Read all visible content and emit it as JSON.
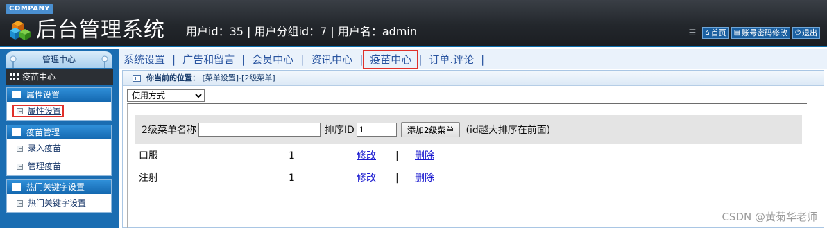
{
  "header": {
    "company": "COMPANY",
    "title": "后台管理系统",
    "user_info": "用户id：35 | 用户分组id：7 | 用户名：admin",
    "links": [
      {
        "label": "首页",
        "icon": "home-icon"
      },
      {
        "label": "账号密码修改",
        "icon": "document-icon"
      },
      {
        "label": "退出",
        "icon": "power-icon"
      }
    ]
  },
  "sidebar": {
    "center_label": "管理中心",
    "current_module": "疫苗中心",
    "groups": [
      {
        "title": "属性设置",
        "items": [
          "属性设置"
        ]
      },
      {
        "title": "疫苗管理",
        "items": [
          "录入疫苗",
          "管理疫苗"
        ]
      },
      {
        "title": "热门关键字设置",
        "items": [
          "热门关键字设置"
        ]
      }
    ]
  },
  "topnav": {
    "items": [
      "系统设置",
      "广告和留言",
      "会员中心",
      "资讯中心",
      "疫苗中心",
      "订单.评论"
    ],
    "active": "疫苗中心",
    "separator": "|"
  },
  "main": {
    "breadcrumb_label": "你当前的位置：",
    "breadcrumb_path": "[菜单设置]-[2级菜单]",
    "select_value": "使用方式",
    "form": {
      "name_label": "2级菜单名称",
      "name_value": "",
      "sort_label": "排序ID",
      "sort_value": "1",
      "add_button": "添加2级菜单",
      "hint": "(id越大排序在前面)"
    },
    "rows": [
      {
        "name": "口服",
        "order": "1",
        "edit": "修改",
        "sep": "|",
        "delete": "删除"
      },
      {
        "name": "注射",
        "order": "1",
        "edit": "修改",
        "sep": "|",
        "delete": "删除"
      }
    ]
  },
  "watermark": "CSDN @黄菊华老师",
  "colors": {
    "header_bg": "#23272c",
    "sidebar_bg": "#1a6db2",
    "link_blue": "#1a1ad0",
    "highlight_red": "#e0302a"
  }
}
